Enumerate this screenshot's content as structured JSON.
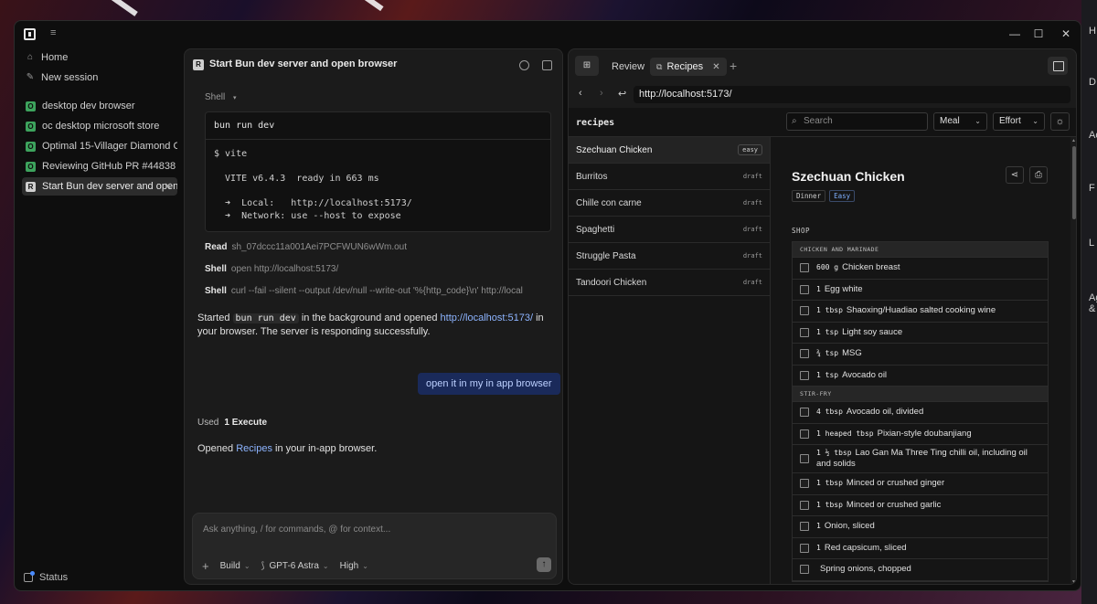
{
  "desktop": {
    "right_peek": [
      "H",
      "D",
      "Ac",
      "F",
      "L",
      "Ag",
      "&"
    ]
  },
  "window": {
    "controls": {
      "minimize": "—",
      "maximize": "☐",
      "close": "✕"
    }
  },
  "sidebar": {
    "home": "Home",
    "new_session": "New session",
    "sessions": [
      {
        "badge": "O",
        "label": "desktop dev browser"
      },
      {
        "badge": "O",
        "label": "oc desktop microsoft store"
      },
      {
        "badge": "O",
        "label": "Optimal 15-Villager Diamond Gear"
      },
      {
        "badge": "O",
        "label": "Reviewing GitHub PR #44838"
      },
      {
        "badge": "R",
        "label": "Start Bun dev server and open"
      }
    ],
    "status": "Status"
  },
  "chat": {
    "badge": "R",
    "title": "Start Bun dev server and open browser",
    "more": "···",
    "shell_label": "Shell",
    "shell_cmd": "bun run dev",
    "shell_output": "$ vite\n\n  VITE v6.4.3  ready in 663 ms\n\n  ➜  Local:   http://localhost:5173/\n  ➜  Network: use --host to expose",
    "tools": [
      {
        "name": "Read",
        "arg": "sh_07dccc11a001Aei7PCFWUN6wWm.out"
      },
      {
        "name": "Shell",
        "arg": "open http://localhost:5173/"
      },
      {
        "name": "Shell",
        "arg": "curl --fail --silent --output /dev/null --write-out '%{http_code}\\n' http://local"
      }
    ],
    "reply1": {
      "a": "Started ",
      "code": "bun run dev",
      "b": " in the background and opened ",
      "link": "http://localhost:5173/",
      "c": " in your browser. The server is responding successfully."
    },
    "user_msg": "open it in my in app browser",
    "used_label": "Used",
    "used_value": "1 Execute",
    "reply2": {
      "a": "Opened ",
      "link": "Recipes",
      "b": " in your in-app browser."
    },
    "composer": {
      "placeholder": "Ask anything, / for commands, @ for context...",
      "plus": "+",
      "mode": "Build",
      "model": "GPT-6 Astra",
      "effort": "High"
    }
  },
  "browser": {
    "tabs": {
      "review": "Review",
      "recipes": "Recipes",
      "close": "✕",
      "add": "+"
    },
    "url": "http://localhost:5173/",
    "page": {
      "brand": "recipes",
      "search_placeholder": "Search",
      "meal_select": "Meal",
      "effort_select": "Effort",
      "recipes": [
        {
          "name": "Szechuan Chicken",
          "status": "easy"
        },
        {
          "name": "Burritos",
          "status": "draft"
        },
        {
          "name": "Chille con carne",
          "status": "draft"
        },
        {
          "name": "Spaghetti",
          "status": "draft"
        },
        {
          "name": "Struggle Pasta",
          "status": "draft"
        },
        {
          "name": "Tandoori Chicken",
          "status": "draft"
        }
      ],
      "detail": {
        "title": "Szechuan Chicken",
        "tags": [
          "Dinner",
          "Easy"
        ],
        "shop_label": "SHOP",
        "groups": [
          {
            "name": "CHICKEN AND MARINADE",
            "items": [
              {
                "qty": "600 g",
                "text": "Chicken breast"
              },
              {
                "qty": "1",
                "text": "Egg white"
              },
              {
                "qty": "1 tbsp",
                "text": "Shaoxing/Huadiao salted cooking wine"
              },
              {
                "qty": "1 tsp",
                "text": "Light soy sauce"
              },
              {
                "qty": "¾ tsp",
                "text": "MSG"
              },
              {
                "qty": "1 tsp",
                "text": "Avocado oil"
              }
            ]
          },
          {
            "name": "STIR-FRY",
            "items": [
              {
                "qty": "4 tbsp",
                "text": "Avocado oil, divided"
              },
              {
                "qty": "1 heaped tbsp",
                "text": "Pixian-style doubanjiang"
              },
              {
                "qty": "1 ½ tbsp",
                "text": "Lao Gan Ma Three Ting chilli oil, including oil and solids"
              },
              {
                "qty": "1 tbsp",
                "text": "Minced or crushed ginger"
              },
              {
                "qty": "1 tbsp",
                "text": "Minced or crushed garlic"
              },
              {
                "qty": "1",
                "text": "Onion, sliced"
              },
              {
                "qty": "1",
                "text": "Red capsicum, sliced"
              },
              {
                "qty": "",
                "text": "Spring onions, chopped"
              }
            ]
          }
        ]
      }
    }
  }
}
